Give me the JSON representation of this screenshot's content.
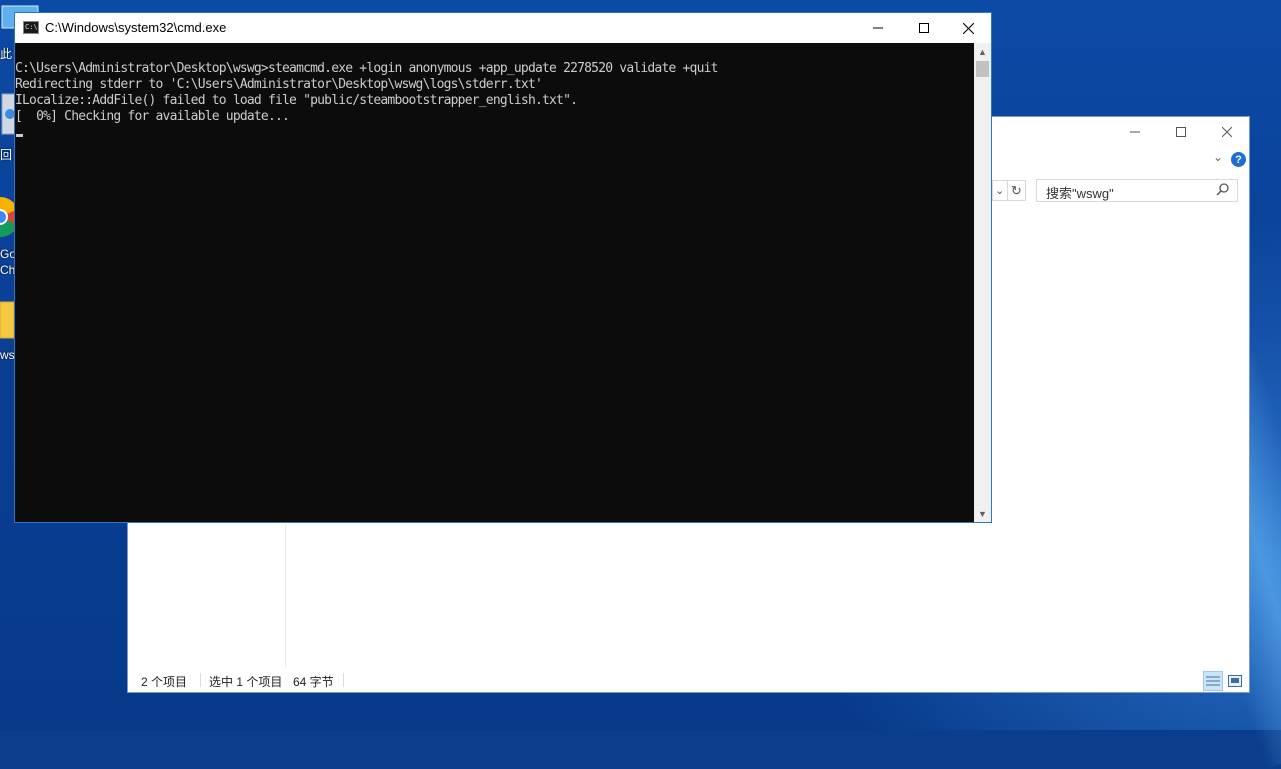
{
  "desktop": {
    "icons": [
      {
        "label": "此",
        "icon": "this-pc-icon"
      },
      {
        "label": "回",
        "icon": "recycle-bin-icon"
      },
      {
        "label": "Go",
        "label2": "Chr",
        "icon": "chrome-icon"
      },
      {
        "label": "ws",
        "icon": "folder-icon"
      }
    ]
  },
  "cmd": {
    "title": "C:\\Windows\\system32\\cmd.exe",
    "lines": [
      "C:\\Users\\Administrator\\Desktop\\wswg>steamcmd.exe +login anonymous +app_update 2278520 validate +quit",
      "Redirecting stderr to 'C:\\Users\\Administrator\\Desktop\\wswg\\logs\\stderr.txt'",
      "ILocalize::AddFile() failed to load file \"public/steambootstrapper_english.txt\".",
      "[  0%] Checking for available update..."
    ],
    "scroll_position": 0
  },
  "explorer": {
    "search_placeholder": "搜索\"wswg\"",
    "status": {
      "item_count": "2 个项目",
      "selected": "选中 1 个项目",
      "size": "64 字节"
    },
    "help_glyph": "?"
  },
  "colors": {
    "console_bg": "#0c0c0c",
    "console_text": "#cccccc",
    "desktop": "#0a3f95",
    "window_border": "#2c77c6"
  }
}
